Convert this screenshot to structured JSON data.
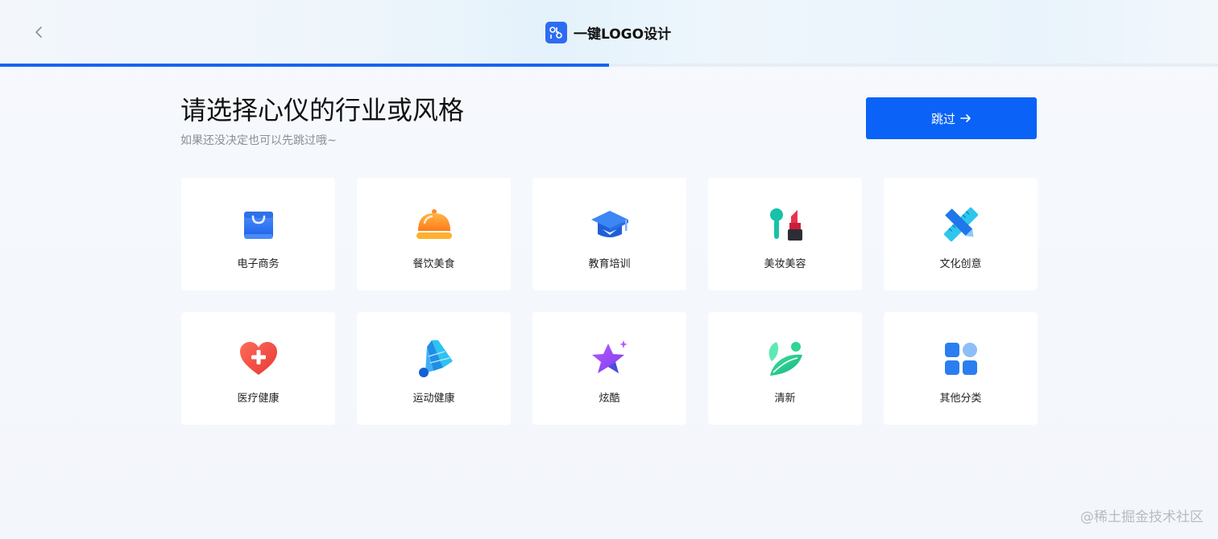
{
  "header": {
    "back_icon": "chevron-left-icon",
    "logo_icon": "logo-icon",
    "title": "一键LOGO设计",
    "progress": 0.5
  },
  "main": {
    "heading": "请选择心仪的行业或风格",
    "subheading": "如果还没决定也可以先跳过哦~",
    "skip_label": "跳过",
    "skip_icon": "arrow-right-icon"
  },
  "categories": [
    {
      "label": "电子商务",
      "icon": "shopping-bag-icon"
    },
    {
      "label": "餐饮美食",
      "icon": "food-cloche-icon"
    },
    {
      "label": "教育培训",
      "icon": "graduation-cap-icon"
    },
    {
      "label": "美妆美容",
      "icon": "lipstick-icon"
    },
    {
      "label": "文化创意",
      "icon": "ruler-pencil-icon"
    },
    {
      "label": "医疗健康",
      "icon": "heart-plus-icon"
    },
    {
      "label": "运动健康",
      "icon": "shuttlecock-icon"
    },
    {
      "label": "炫酷",
      "icon": "star-icon"
    },
    {
      "label": "清新",
      "icon": "leaf-icon"
    },
    {
      "label": "其他分类",
      "icon": "grid-icon"
    }
  ],
  "watermark": "@稀土掘金技术社区",
  "colors": {
    "accent": "#0a62f7",
    "progress": "#1763f2"
  }
}
